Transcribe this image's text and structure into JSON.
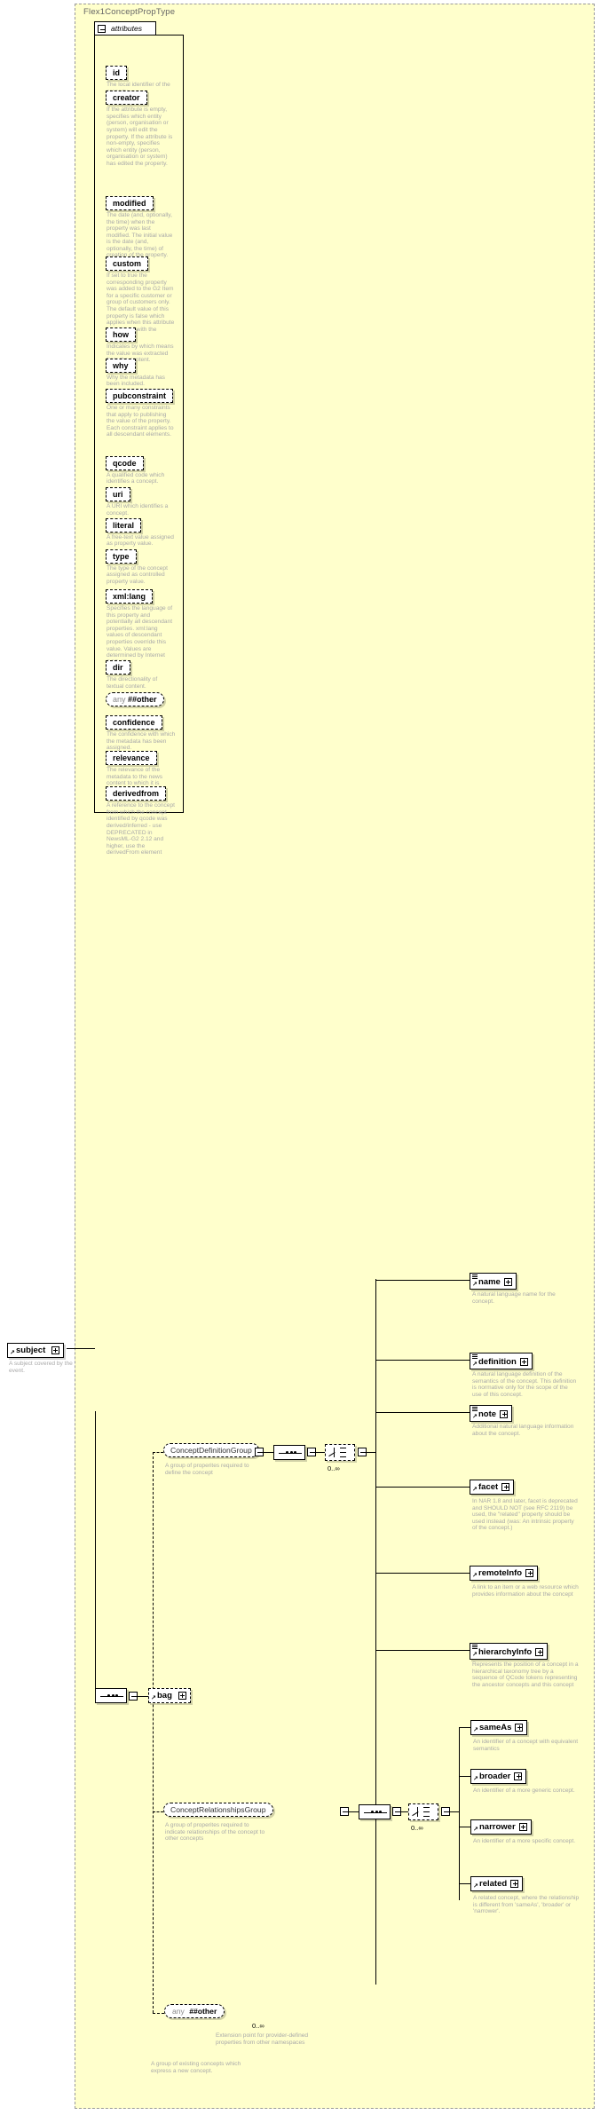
{
  "diagram": {
    "type_name": "Flex1ConceptPropType",
    "attributes_label": "attributes",
    "root": {
      "name": "subject",
      "desc": "A subject covered by the event."
    },
    "attributes": [
      {
        "name": "id",
        "desc": "The local identifier of the property."
      },
      {
        "name": "creator",
        "desc": "If the attribute is empty, specifies which entity (person, organisation or system) will edit the property. If the attribute is non-empty, specifies which entity (person, organisation or system) has edited the property."
      },
      {
        "name": "modified",
        "desc": "The date (and, optionally, the time) when the property was last modified. The initial value is the date (and, optionally, the time) of creation of the property."
      },
      {
        "name": "custom",
        "desc": "If set to true the corresponding property was added to the G2 Item for a specific customer or group of customers only. The default value of this property is false which applies when this attribute is not used with the property."
      },
      {
        "name": "how",
        "desc": "Indicates by which means the value was extracted from the content."
      },
      {
        "name": "why",
        "desc": "Why the metadata has been included."
      },
      {
        "name": "pubconstraint",
        "desc": "One or many constraints that apply to publishing the value of the property. Each constraint applies to all descendant elements."
      },
      {
        "name": "qcode",
        "desc": "A qualified code which identifies a concept."
      },
      {
        "name": "uri",
        "desc": "A URI which identifies a concept."
      },
      {
        "name": "literal",
        "desc": "A free-text value assigned as property value."
      },
      {
        "name": "type",
        "desc": "The type of the concept assigned as controlled property value."
      },
      {
        "name": "xml:lang",
        "desc": "Specifies the language of this property and potentially all descendant properties. xml:lang values of descendant properties override this value. Values are determined by Internet BCP 47."
      },
      {
        "name": "dir",
        "desc": "The directionality of textual content."
      },
      {
        "name": "any ##other",
        "desc": "",
        "is_any": true
      },
      {
        "name": "confidence",
        "desc": "The confidence with which the metadata has been assigned."
      },
      {
        "name": "relevance",
        "desc": "The relevance of the metadata to the news content to which it is attached."
      },
      {
        "name": "derivedfrom",
        "desc": "A reference to the concept from which the concept identified by qcode was derived/inferred - use DEPRECATED in NewsML-G2 2.12 and higher, use the derivedFrom element"
      }
    ],
    "groups": [
      {
        "name": "ConceptDefinitionGroup",
        "desc": "A group of properites required to define the concept",
        "occurs": "0..∞",
        "children": [
          {
            "name": "name",
            "desc": "A natural language name for the concept.",
            "doc_icon": true
          },
          {
            "name": "definition",
            "desc": "A natural language definition of the semantics of the concept. This definition is normative only for the scope of the use of this concept.",
            "doc_icon": true
          },
          {
            "name": "note",
            "desc": "Additional natural language information about the concept.",
            "doc_icon": true
          },
          {
            "name": "facet",
            "desc": "In NAR 1.8 and later, facet is deprecated and SHOULD NOT (see RFC 2119) be used, the \"related\" property should be used instead (was: An intrinsic property of the concept.)",
            "doc_icon": false
          },
          {
            "name": "remoteInfo",
            "desc": "A link to an item or a web resource which provides information about the concept",
            "doc_icon": false
          },
          {
            "name": "hierarchyInfo",
            "desc": "Represents the position of a concept in a hierarchical taxonomy tree by a sequence of QCode tokens representing the ancestor concepts and this concept",
            "doc_icon": true
          }
        ]
      },
      {
        "name": "ConceptRelationshipsGroup",
        "desc": "A group of properites required to indicate relationships of the concept to other concepts",
        "occurs": "0..∞",
        "children": [
          {
            "name": "sameAs",
            "desc": "An identifier of a concept with equivalent semantics",
            "doc_icon": false
          },
          {
            "name": "broader",
            "desc": "An identifier of a more generic concept.",
            "doc_icon": false
          },
          {
            "name": "narrower",
            "desc": "An identifier of a more specific concept.",
            "doc_icon": false
          },
          {
            "name": "related",
            "desc": "A related concept, where the relationship is different from 'sameAs', 'broader' or 'narrower'.",
            "doc_icon": false
          }
        ]
      }
    ],
    "extension": {
      "name_prefix": "any",
      "name_suffix": "##other",
      "occurs": "0..∞",
      "desc": "Extension point for provider-defined properties from other namespaces"
    },
    "bag": {
      "name": "bag",
      "desc": "A group of existing concepts which express a new concept."
    }
  }
}
